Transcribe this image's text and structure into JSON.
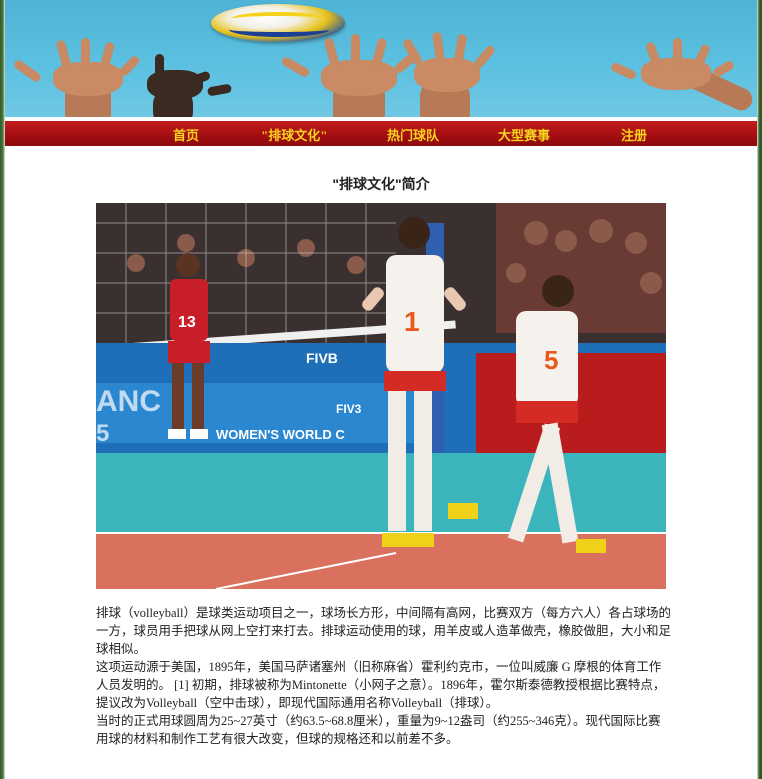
{
  "nav": {
    "items": [
      {
        "label": "首页"
      },
      {
        "label": "\"排球文化\""
      },
      {
        "label": "热门球队"
      },
      {
        "label": "大型赛事"
      },
      {
        "label": "注册"
      }
    ]
  },
  "article": {
    "title": "\"排球文化\"简介",
    "photo": {
      "board_text_1": "FIVB",
      "board_text_2": "FIV3",
      "board_text_3": "WOMEN'S WORLD C",
      "board_text_4": "ANC",
      "board_text_5": "5",
      "jersey_left": "13",
      "jersey_mid": "1",
      "jersey_right": "5"
    },
    "paragraphs": [
      "排球（volleyball）是球类运动项目之一，球场长方形，中间隔有高网，比赛双方（每方六人）各占球场的一方，球员用手把球从网上空打来打去。排球运动使用的球，用羊皮或人造革做壳，橡胶做胆，大小和足球相似。",
      "这项运动源于美国，1895年，美国马萨诸塞州（旧称麻省）霍利约克市，一位叫威廉 G 摩根的体育工作人员发明的。 [1] 初期，排球被称为Mintonette（小网子之意）。1896年，霍尔斯泰德教授根据比赛特点，提议改为Volleyball（空中击球），即现代国际通用名称Volleyball（排球）。",
      "当时的正式用球圆周为25~27英寸（约63.5~68.8厘米），重量为9~12盎司（约255~346克）。现代国际比赛用球的材料和制作工艺有很大改变，但球的规格还和以前差不多。"
    ]
  },
  "colors": {
    "nav_bg": "#a80f12",
    "nav_text": "#f6d41d",
    "banner_sky": "#5cc0e0"
  }
}
